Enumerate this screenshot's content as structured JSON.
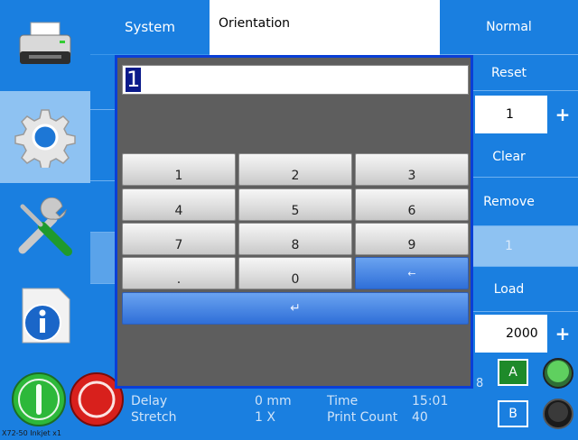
{
  "header": {
    "system_label": "System",
    "orientation_label": "Orientation",
    "orientation_value": ""
  },
  "right_panel": {
    "normal": "Normal",
    "reset": "Reset",
    "count_value": "1",
    "count_plus": "+",
    "clear": "Clear",
    "remove": "Remove",
    "disabled_value": "1",
    "load": "Load",
    "load_value": "2000",
    "load_plus": "+",
    "channel_a": "A",
    "channel_b": "B",
    "partial_number": "8"
  },
  "sidebar": {
    "items": [
      {
        "icon": "printer-icon"
      },
      {
        "icon": "gear-icon"
      },
      {
        "icon": "tools-icon"
      },
      {
        "icon": "info-icon"
      }
    ]
  },
  "status": {
    "delay_label": "Delay",
    "delay_value": "0 mm",
    "stretch_label": "Stretch",
    "stretch_value": "1 X",
    "time_label": "Time",
    "time_value": "15:01",
    "print_count_label": "Print Count",
    "print_count_value": "40",
    "device_name": "X72-50 Inkjet x1"
  },
  "keypad": {
    "input_value": "1",
    "keys": [
      "1",
      "2",
      "3",
      "4",
      "5",
      "6",
      "7",
      "8",
      "9",
      ".",
      "0",
      "←"
    ],
    "enter": "↵"
  },
  "colors": {
    "primary_blue": "#1a7fe0",
    "light_blue": "#8ec2f2",
    "modal_border": "#0a3fd6",
    "start_green": "#2db83a",
    "stop_red": "#d8201c"
  }
}
